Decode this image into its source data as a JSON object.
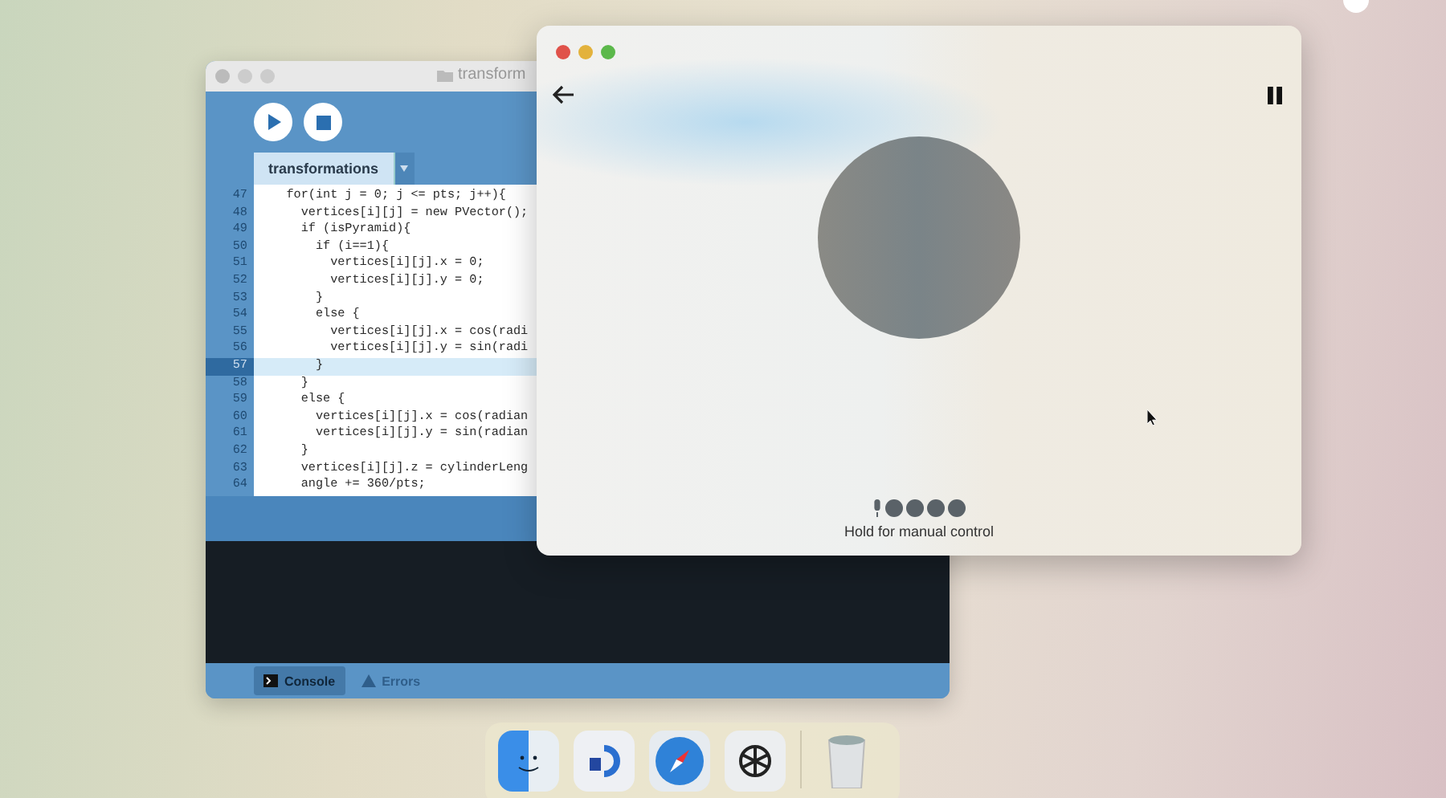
{
  "editor_window": {
    "title": "transform",
    "tab": {
      "label": "transformations"
    },
    "lines": [
      {
        "number": "47",
        "code": "    for(int j = 0; j <= pts; j++){",
        "current": false
      },
      {
        "number": "48",
        "code": "      vertices[i][j] = new PVector();",
        "current": false
      },
      {
        "number": "49",
        "code": "      if (isPyramid){",
        "current": false
      },
      {
        "number": "50",
        "code": "        if (i==1){",
        "current": false
      },
      {
        "number": "51",
        "code": "          vertices[i][j].x = 0;",
        "current": false
      },
      {
        "number": "52",
        "code": "          vertices[i][j].y = 0;",
        "current": false
      },
      {
        "number": "53",
        "code": "        }",
        "current": false
      },
      {
        "number": "54",
        "code": "        else {",
        "current": false
      },
      {
        "number": "55",
        "code": "          vertices[i][j].x = cos(radi",
        "current": false
      },
      {
        "number": "56",
        "code": "          vertices[i][j].y = sin(radi",
        "current": false
      },
      {
        "number": "57",
        "code": "        }",
        "current": true
      },
      {
        "number": "58",
        "code": "      }",
        "current": false
      },
      {
        "number": "59",
        "code": "      else {",
        "current": false
      },
      {
        "number": "60",
        "code": "        vertices[i][j].x = cos(radian",
        "current": false
      },
      {
        "number": "61",
        "code": "        vertices[i][j].y = sin(radian",
        "current": false
      },
      {
        "number": "62",
        "code": "      }",
        "current": false
      },
      {
        "number": "63",
        "code": "      vertices[i][j].z = cylinderLeng",
        "current": false
      },
      {
        "number": "64",
        "code": "      angle += 360/pts;",
        "current": false
      }
    ],
    "bottom_tabs": [
      {
        "label": "Console",
        "selected": true
      },
      {
        "label": "Errors",
        "selected": false
      }
    ]
  },
  "voice_window": {
    "status": "Hold for manual control"
  }
}
